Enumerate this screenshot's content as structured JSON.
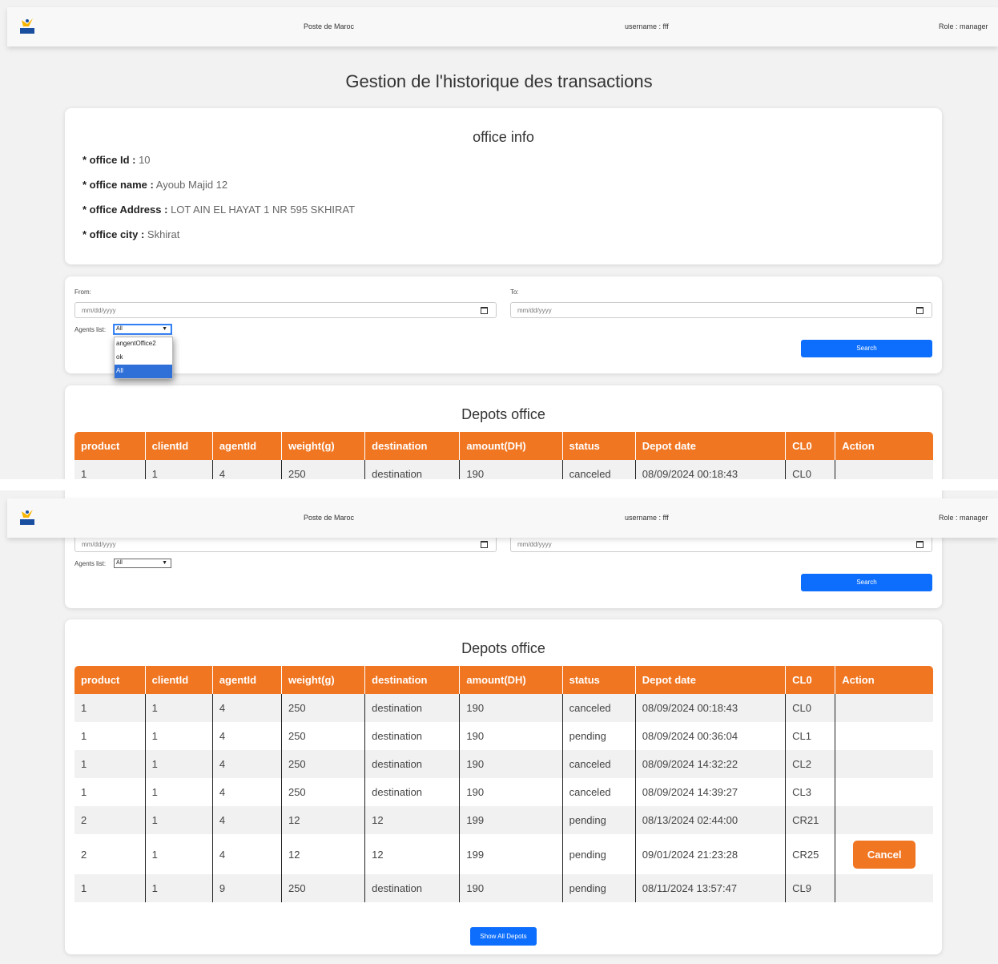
{
  "navbar": {
    "brand": "Poste de Maroc",
    "username": "username : fff",
    "role": "Role : manager",
    "logo_icon": "poste-maroc-logo-icon"
  },
  "page_title": "Gestion de l'historique des transactions",
  "office_info": {
    "title": "office info",
    "fields": [
      {
        "label": "* office Id :",
        "value": "10"
      },
      {
        "label": "* office name :",
        "value": "Ayoub Majid 12"
      },
      {
        "label": "* office Address :",
        "value": "LOT AIN EL HAYAT 1 NR 595 SKHIRAT"
      },
      {
        "label": "* office city :",
        "value": "Skhirat"
      }
    ]
  },
  "filters": {
    "from_label": "From:",
    "to_label": "To:",
    "from_placeholder": "mm/dd/yyyy",
    "to_placeholder": "mm/dd/yyyy",
    "agents_label": "Agents list:",
    "agents_selected": "All",
    "agents_options": [
      "angentOffice2",
      "ok",
      "All"
    ],
    "search_label": "Search"
  },
  "depots": {
    "title": "Depots office",
    "columns": [
      "product",
      "clientId",
      "agentId",
      "weight(g)",
      "destination",
      "amount(DH)",
      "status",
      "Depot date",
      "CL0",
      "Action"
    ],
    "rows": [
      [
        "1",
        "1",
        "4",
        "250",
        "destination",
        "190",
        "canceled",
        "08/09/2024 00:18:43",
        "CL0",
        ""
      ],
      [
        "1",
        "1",
        "4",
        "250",
        "destination",
        "190",
        "pending",
        "08/09/2024 00:36:04",
        "CL1",
        ""
      ],
      [
        "1",
        "1",
        "4",
        "250",
        "destination",
        "190",
        "canceled",
        "08/09/2024 14:32:22",
        "CL2",
        ""
      ],
      [
        "1",
        "1",
        "4",
        "250",
        "destination",
        "190",
        "canceled",
        "08/09/2024 14:39:27",
        "CL3",
        ""
      ],
      [
        "2",
        "1",
        "4",
        "12",
        "12",
        "199",
        "pending",
        "08/13/2024 02:44:00",
        "CR21",
        ""
      ],
      [
        "2",
        "1",
        "4",
        "12",
        "12",
        "199",
        "pending",
        "09/01/2024 21:23:28",
        "CR25",
        "Cancel"
      ],
      [
        "1",
        "1",
        "9",
        "250",
        "destination",
        "190",
        "pending",
        "08/11/2024 13:57:47",
        "CL9",
        ""
      ]
    ],
    "show_all_label": "Show All Depots"
  },
  "colors": {
    "accent_orange": "#f07622",
    "primary_blue": "#0d6efd",
    "background": "#f2f2f2"
  }
}
